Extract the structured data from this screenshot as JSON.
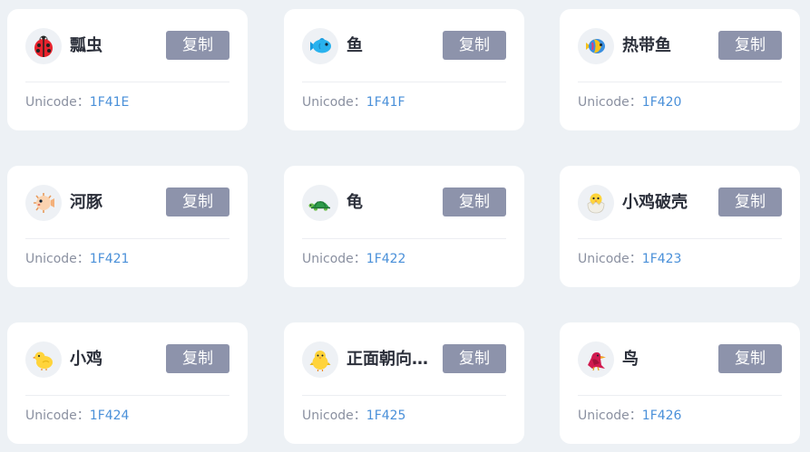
{
  "cards": [
    {
      "name": "瓢虫",
      "button": "复制",
      "unicode_label": "Unicode：",
      "code": "1F41E",
      "icon": "ladybug-icon"
    },
    {
      "name": "鱼",
      "button": "复制",
      "unicode_label": "Unicode：",
      "code": "1F41F",
      "icon": "fish-icon"
    },
    {
      "name": "热带鱼",
      "button": "复制",
      "unicode_label": "Unicode：",
      "code": "1F420",
      "icon": "tropical-fish-icon"
    },
    {
      "name": "河豚",
      "button": "复制",
      "unicode_label": "Unicode：",
      "code": "1F421",
      "icon": "blowfish-icon"
    },
    {
      "name": "龟",
      "button": "复制",
      "unicode_label": "Unicode：",
      "code": "1F422",
      "icon": "turtle-icon"
    },
    {
      "name": "小鸡破壳",
      "button": "复制",
      "unicode_label": "Unicode：",
      "code": "1F423",
      "icon": "hatching-chick-icon"
    },
    {
      "name": "小鸡",
      "button": "复制",
      "unicode_label": "Unicode：",
      "code": "1F424",
      "icon": "baby-chick-icon"
    },
    {
      "name": "正面朝向的…",
      "button": "复制",
      "unicode_label": "Unicode：",
      "code": "1F425",
      "icon": "front-facing-chick-icon"
    },
    {
      "name": "鸟",
      "button": "复制",
      "unicode_label": "Unicode：",
      "code": "1F426",
      "icon": "bird-icon"
    }
  ],
  "colors": {
    "page_bg": "#edf1f5",
    "card_bg": "#ffffff",
    "button_bg": "#8d93ab",
    "code_text": "#4a90d9",
    "label_text": "#8a90a0",
    "name_text": "#2b2f3a"
  }
}
